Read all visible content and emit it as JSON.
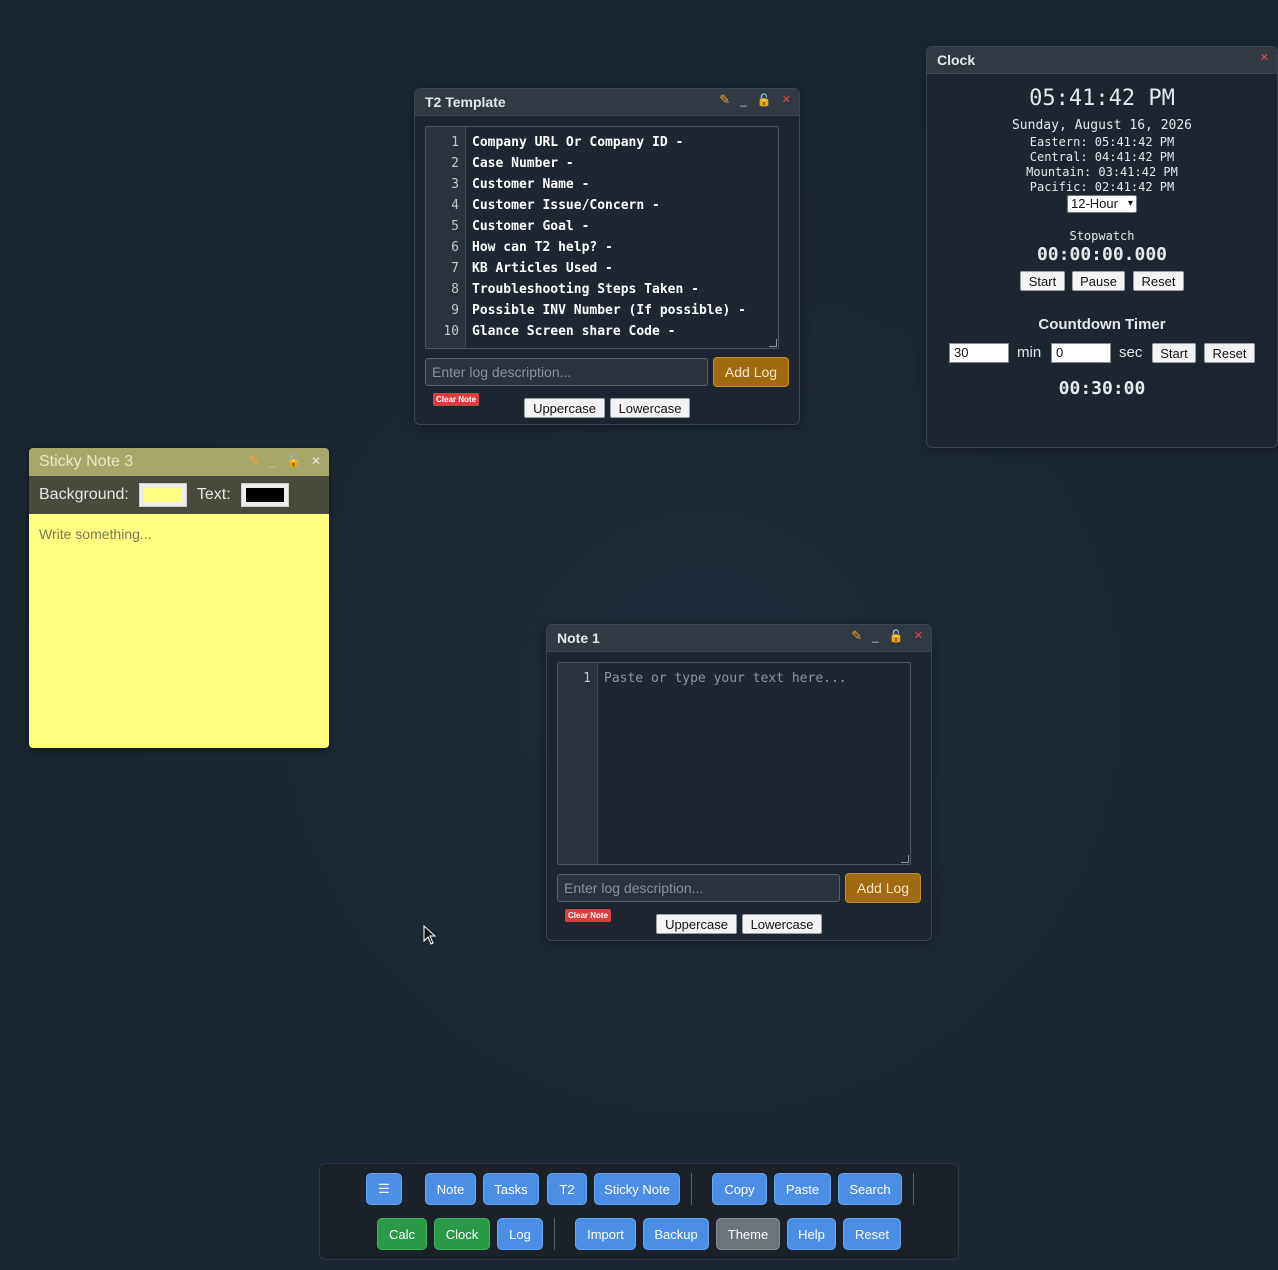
{
  "t2_window": {
    "title": "T2 Template",
    "lines": [
      "Company URL Or Company ID -",
      "Case Number -",
      "Customer Name -",
      "Customer Issue/Concern -",
      "Customer Goal -",
      "How can T2 help? -",
      "KB Articles Used -",
      "Troubleshooting Steps Taken -",
      "Possible INV Number (If possible) -",
      "Glance Screen share Code -"
    ],
    "line_numbers": [
      "1",
      "2",
      "3",
      "4",
      "5",
      "6",
      "7",
      "8",
      "9",
      "10"
    ],
    "log_placeholder": "Enter log description...",
    "add_log_label": "Add Log",
    "clear_note_label": "Clear Note",
    "uppercase_label": "Uppercase",
    "lowercase_label": "Lowercase"
  },
  "clock_window": {
    "title": "Clock",
    "time": "05:41:42 PM",
    "date": "Sunday, August 16, 2026",
    "zones": [
      "Eastern: 05:41:42 PM",
      "Central: 04:41:42 PM",
      "Mountain: 03:41:42 PM",
      "Pacific: 02:41:42 PM"
    ],
    "format_selected": "12-Hour",
    "stopwatch_label": "Stopwatch",
    "stopwatch_value": "00:00:00.000",
    "sw_start": "Start",
    "sw_pause": "Pause",
    "sw_reset": "Reset",
    "countdown_label": "Countdown Timer",
    "min_value": "30",
    "min_label": "min",
    "sec_value": "0",
    "sec_label": "sec",
    "cd_start": "Start",
    "cd_reset": "Reset",
    "countdown_value": "00:30:00"
  },
  "sticky": {
    "title": "Sticky Note 3",
    "background_label": "Background:",
    "text_label": "Text:",
    "bg_color": "#ffff80",
    "text_color": "#000000",
    "placeholder": "Write something..."
  },
  "note1": {
    "title": "Note 1",
    "line_numbers": [
      "1"
    ],
    "placeholder": "Paste or type your text here...",
    "log_placeholder": "Enter log description...",
    "add_log_label": "Add Log",
    "clear_note_label": "Clear Note",
    "uppercase_label": "Uppercase",
    "lowercase_label": "Lowercase"
  },
  "toolbar": {
    "menu_label": "☰",
    "note": "Note",
    "tasks": "Tasks",
    "t2": "T2",
    "sticky_note": "Sticky Note",
    "copy": "Copy",
    "paste": "Paste",
    "search": "Search",
    "calc": "Calc",
    "clock": "Clock",
    "log": "Log",
    "import": "Import",
    "backup": "Backup",
    "theme": "Theme",
    "help": "Help",
    "reset": "Reset"
  },
  "colors": {
    "accent_blue": "#4a8ee6",
    "accent_green": "#2a9a48",
    "add_log_orange": "#a06a10",
    "clear_red": "#d93f3f"
  }
}
